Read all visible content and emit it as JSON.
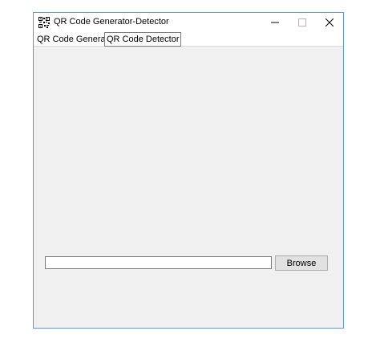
{
  "window": {
    "title": "QR Code Generator-Detector",
    "accent_color": "#5b9bd5",
    "background_color": "#f0f0f0"
  },
  "title_controls": {
    "minimize_icon": "minimize-icon",
    "maximize_icon": "maximize-icon",
    "close_icon": "close-icon"
  },
  "tabs": [
    {
      "label": "QR Code Generator",
      "selected": false
    },
    {
      "label": "QR Code Detector",
      "selected": true
    }
  ],
  "detector": {
    "path_value": "",
    "browse_label": "Browse"
  }
}
